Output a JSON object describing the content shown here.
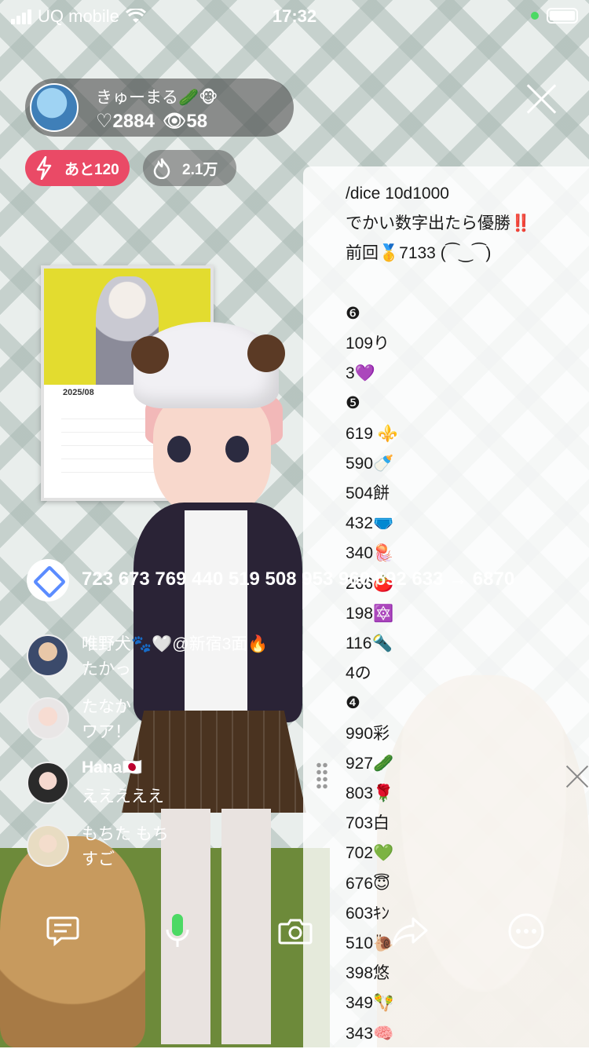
{
  "status_bar": {
    "carrier": "UQ mobile",
    "time": "17:32"
  },
  "host": {
    "name": "きゅーまる🥒🐵",
    "likes": "♡2884",
    "viewers": "👁58"
  },
  "badges": {
    "remaining": "あと120",
    "points": "2.1万"
  },
  "calendar": {
    "month": "2025/08"
  },
  "panel": {
    "lines": [
      "/dice 10d1000",
      "でかい数字出たら優勝‼️",
      "前回🥇7133 (⁀‿⁀)",
      "",
      "❻",
      "109り",
      "3💜",
      "❺",
      "619 ⚜️",
      "590🍼",
      "504餅",
      "432🩲",
      "340🪼",
      "266🍅",
      "198🔯",
      "116🔦",
      "4の",
      "❹",
      "990彩",
      "927🥒",
      "803🌹",
      "703白",
      "702💚",
      "676😇",
      "603ｷﾝ",
      "510🐌",
      "398悠",
      "349🪇",
      "343🧠"
    ]
  },
  "system_message": "723 673 769 440 519 508 953 960 692 633 → 6870",
  "comments": [
    {
      "name": "唯野犬🐾🤍@新宿3面🔥",
      "text": "たかっ"
    },
    {
      "name": "たなか",
      "text": "ワア！"
    },
    {
      "name": "Hana🇯🇵",
      "text": "えええええ"
    },
    {
      "name": "もちた もち",
      "text": "すご"
    }
  ],
  "colors": {
    "accent_red": "#ea4a66",
    "mic_green": "#4cd964",
    "panel_bg": "#ffffff"
  },
  "icons": {
    "toolbar": [
      "chat-icon",
      "mic-icon",
      "camera-icon",
      "share-icon",
      "more-icon"
    ]
  }
}
